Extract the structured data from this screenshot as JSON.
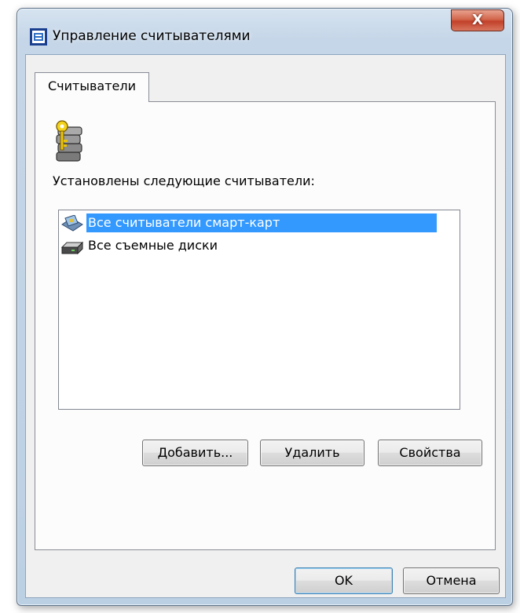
{
  "window": {
    "title": "Управление считывателями",
    "close_label": "X"
  },
  "tabs": [
    {
      "label": "Считыватели",
      "selected": true
    }
  ],
  "panel": {
    "icon": "keys-stack-icon",
    "label": "Установлены следующие считыватели:"
  },
  "readers_list": {
    "items": [
      {
        "label": "Все считыватели смарт-карт",
        "icon": "smart-card-reader-icon",
        "selected": true
      },
      {
        "label": "Все съемные диски",
        "icon": "removable-drive-icon",
        "selected": false
      }
    ]
  },
  "actions": {
    "add_label": "Добавить...",
    "delete_label": "Удалить",
    "properties_label": "Свойства"
  },
  "footer": {
    "ok_label": "OK",
    "cancel_label": "Отмена"
  },
  "colors": {
    "selection": "#3399ff",
    "close_button": "#c2402a",
    "title_bar": "#c5d6e8"
  }
}
